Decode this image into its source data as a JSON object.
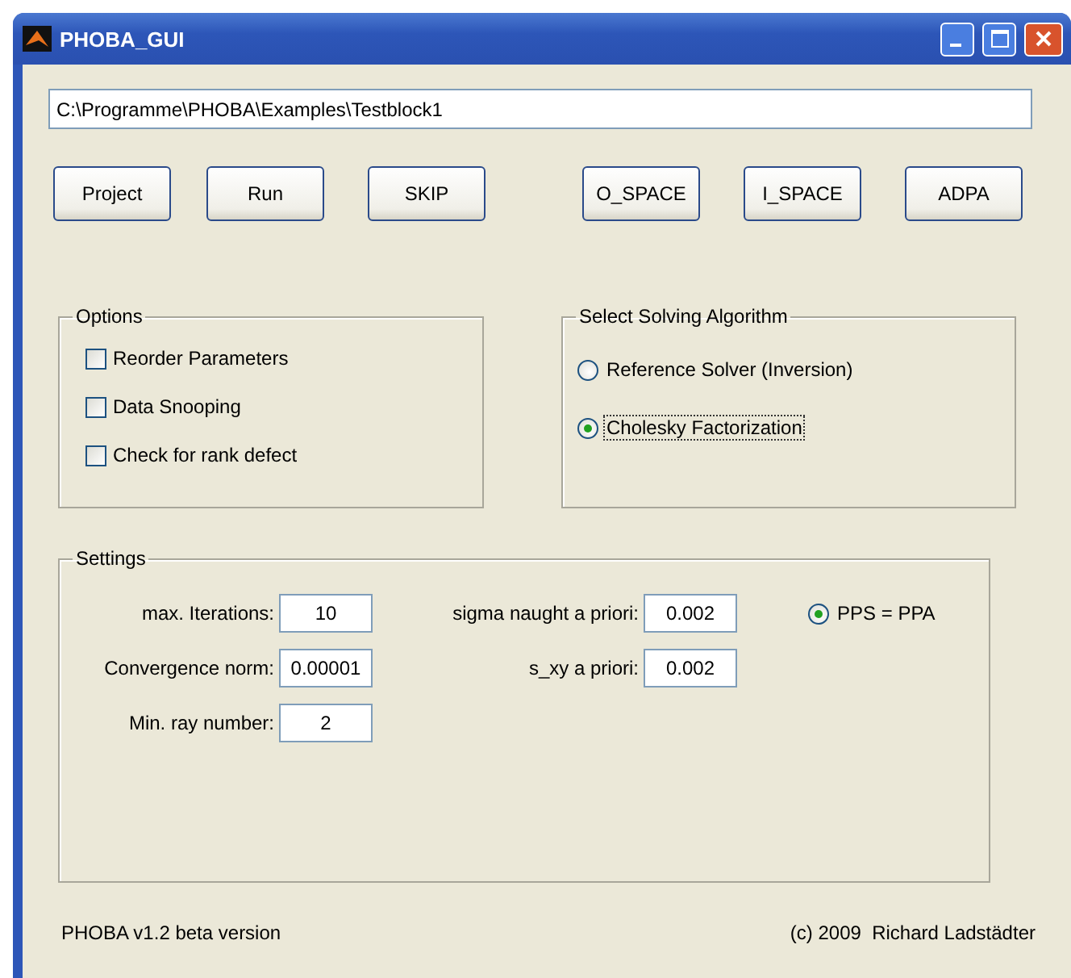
{
  "window": {
    "title": "PHOBA_GUI"
  },
  "path_field": {
    "value": "C:\\Programme\\PHOBA\\Examples\\Testblock1"
  },
  "button_groups": [
    [
      "Project",
      "Run",
      "SKIP"
    ],
    [
      "O_SPACE",
      "I_SPACE",
      "ADPA"
    ]
  ],
  "options": {
    "title": "Options",
    "items": [
      {
        "label": "Reorder Parameters",
        "checked": false
      },
      {
        "label": "Data Snooping",
        "checked": false
      },
      {
        "label": "Check for rank defect",
        "checked": false
      }
    ]
  },
  "algorithm": {
    "title": "Select Solving Algorithm",
    "items": [
      {
        "label": "Reference Solver (Inversion)",
        "selected": false,
        "focused": false
      },
      {
        "label": "Cholesky Factorization",
        "selected": true,
        "focused": true
      }
    ]
  },
  "settings": {
    "title": "Settings",
    "columns": [
      [
        {
          "label": "max. Iterations:",
          "value": "10"
        },
        {
          "label": "Convergence norm:",
          "value": "0.00001"
        },
        {
          "label": "Min. ray number:",
          "value": "2"
        }
      ],
      [
        {
          "label": "sigma naught a priori:",
          "value": "0.002"
        },
        {
          "label": "s_xy a priori:",
          "value": "0.002"
        }
      ]
    ],
    "option": {
      "label": "PPS = PPA",
      "selected": true
    }
  },
  "footer": {
    "version": "PHOBA v1.2 beta version",
    "copyright": "(c) 2009  Richard Ladstädter"
  }
}
